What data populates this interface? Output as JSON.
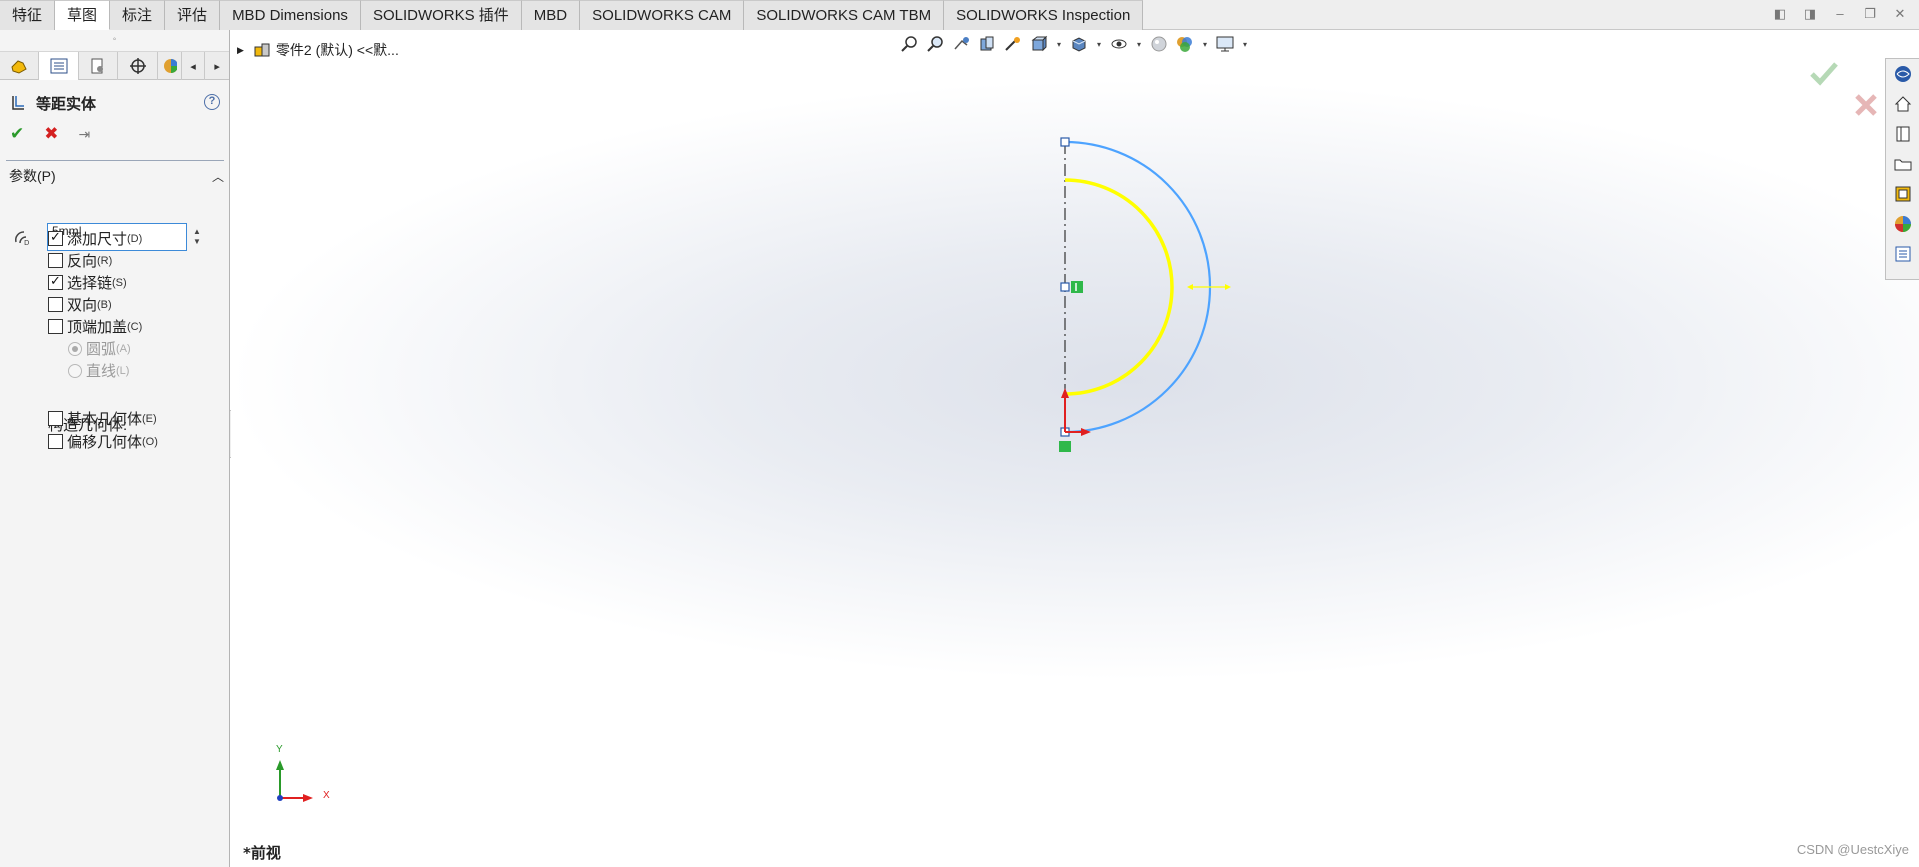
{
  "tabs": [
    {
      "label": "特征",
      "active": false
    },
    {
      "label": "草图",
      "active": true
    },
    {
      "label": "标注",
      "active": false
    },
    {
      "label": "评估",
      "active": false
    },
    {
      "label": "MBD Dimensions",
      "active": false
    },
    {
      "label": "SOLIDWORKS 插件",
      "active": false
    },
    {
      "label": "MBD",
      "active": false
    },
    {
      "label": "SOLIDWORKS CAM",
      "active": false
    },
    {
      "label": "SOLIDWORKS CAM TBM",
      "active": false
    },
    {
      "label": "SOLIDWORKS Inspection",
      "active": false
    }
  ],
  "property_manager": {
    "title": "等距实体",
    "help": "?",
    "section_title": "参数(P)",
    "distance_value": "5mm",
    "options": {
      "add_dims": {
        "label": "添加尺寸",
        "key": "(D)",
        "checked": true
      },
      "reverse": {
        "label": "反向",
        "key": "(R)",
        "checked": false
      },
      "select_chain": {
        "label": "选择链",
        "key": "(S)",
        "checked": true
      },
      "bidirectional": {
        "label": "双向",
        "key": "(B)",
        "checked": false
      },
      "cap_ends": {
        "label": "顶端加盖",
        "key": "(C)",
        "checked": false
      },
      "arc": {
        "label": "圆弧",
        "key": "(A)",
        "selected": true,
        "disabled": true
      },
      "line": {
        "label": "直线",
        "key": "(L)",
        "selected": false,
        "disabled": true
      }
    },
    "construction_label": "构造几何体:",
    "construction": {
      "base": {
        "label": "基本几何体",
        "key": "(E)",
        "checked": false
      },
      "offset": {
        "label": "偏移几何体",
        "key": "(O)",
        "checked": false
      }
    }
  },
  "feature_tree": {
    "part_label": "零件2 (默认) <<默..."
  },
  "viewport": {
    "view_name": "*前视",
    "axis_x": "X",
    "axis_y": "Y",
    "watermark": "CSDN @UestcXiye"
  },
  "colors": {
    "offset_curve": "#ffff00",
    "original_curve": "#4da3ff",
    "centerline": "#333333",
    "relation": "#2fb84a"
  }
}
